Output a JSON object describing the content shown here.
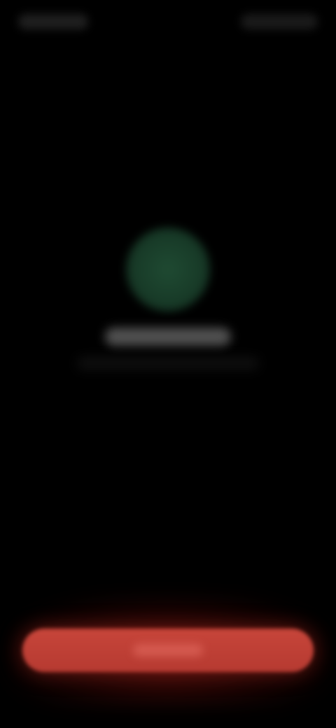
{
  "status_bar": {
    "left_text": "",
    "right_text": ""
  },
  "call": {
    "contact_name": "",
    "subtitle": ""
  },
  "actions": {
    "end_call_label": ""
  },
  "colors": {
    "background": "#000000",
    "avatar": "#1f4a32",
    "end_button": "#c7453a"
  },
  "icons": {
    "avatar": "avatar-icon"
  }
}
